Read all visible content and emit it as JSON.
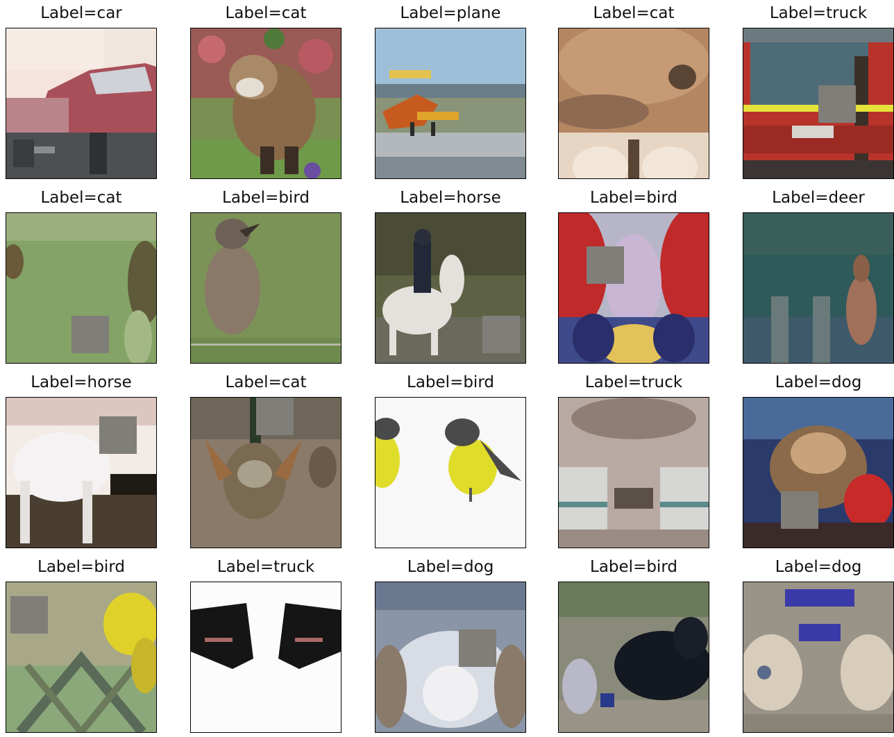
{
  "panels": [
    {
      "label": "Label=car",
      "subject": "car"
    },
    {
      "label": "Label=cat",
      "subject": "cat"
    },
    {
      "label": "Label=plane",
      "subject": "plane"
    },
    {
      "label": "Label=cat",
      "subject": "cat"
    },
    {
      "label": "Label=truck",
      "subject": "truck"
    },
    {
      "label": "Label=cat",
      "subject": "cat"
    },
    {
      "label": "Label=bird",
      "subject": "bird"
    },
    {
      "label": "Label=horse",
      "subject": "horse"
    },
    {
      "label": "Label=bird",
      "subject": "bird"
    },
    {
      "label": "Label=deer",
      "subject": "deer"
    },
    {
      "label": "Label=horse",
      "subject": "horse"
    },
    {
      "label": "Label=cat",
      "subject": "cat"
    },
    {
      "label": "Label=bird",
      "subject": "bird"
    },
    {
      "label": "Label=truck",
      "subject": "truck"
    },
    {
      "label": "Label=dog",
      "subject": "dog"
    },
    {
      "label": "Label=bird",
      "subject": "bird"
    },
    {
      "label": "Label=truck",
      "subject": "truck"
    },
    {
      "label": "Label=dog",
      "subject": "dog"
    },
    {
      "label": "Label=bird",
      "subject": "bird"
    },
    {
      "label": "Label=dog",
      "subject": "dog"
    }
  ],
  "occlusion_color": "#807e79"
}
